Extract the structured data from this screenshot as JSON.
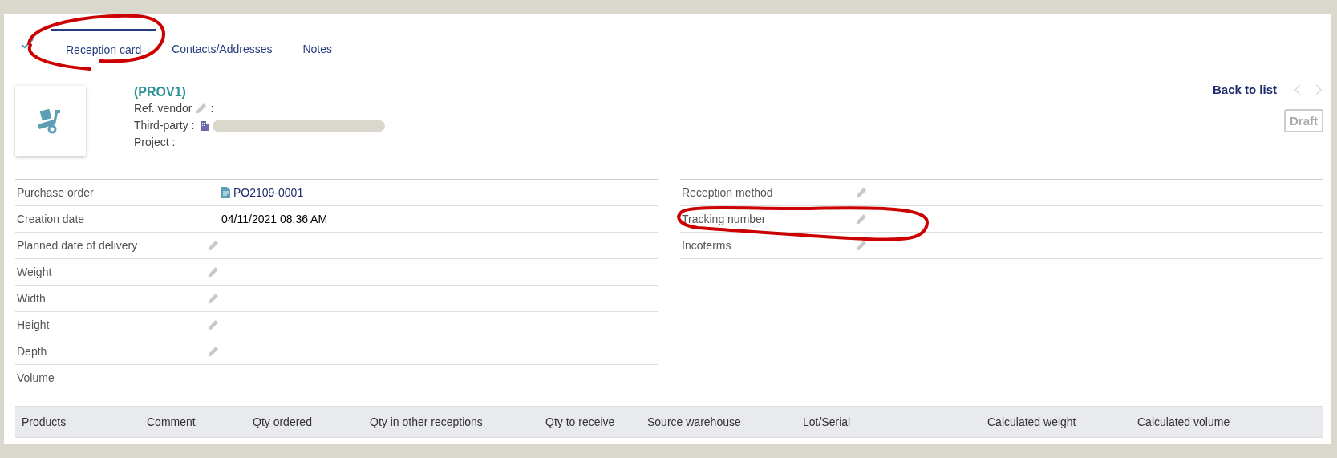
{
  "tabs": [
    {
      "label": "Reception card",
      "selected": true
    },
    {
      "label": "Contacts/Addresses",
      "selected": false
    },
    {
      "label": "Notes",
      "selected": false
    }
  ],
  "header": {
    "ref": "(PROV1)",
    "lines": [
      {
        "label": "Ref. vendor",
        "editable": true,
        "kind": "text",
        "suffix": ":"
      },
      {
        "label": "Third-party :",
        "kind": "company"
      },
      {
        "label": "Project :",
        "kind": "text"
      }
    ],
    "back_link": "Back to list",
    "prev_disabled": true,
    "next_disabled": true,
    "status": "Draft"
  },
  "left_fields": [
    {
      "label": "Purchase order",
      "value": "PO2109-0001",
      "kind": "link",
      "editable": false
    },
    {
      "label": "Creation date",
      "value": "04/11/2021 08:36 AM",
      "kind": "text",
      "editable": false
    },
    {
      "label": "Planned date of delivery",
      "editable": true
    },
    {
      "label": "Weight",
      "editable": true
    },
    {
      "label": "Width",
      "editable": true
    },
    {
      "label": "Height",
      "editable": true
    },
    {
      "label": "Depth",
      "editable": true
    },
    {
      "label": "Volume",
      "editable": false
    }
  ],
  "right_fields": [
    {
      "label": "Reception method",
      "editable": true
    },
    {
      "label": "Tracking number",
      "editable": true
    },
    {
      "label": "Incoterms",
      "editable": true
    }
  ],
  "products_table": {
    "columns": [
      "Products",
      "Comment",
      "Qty ordered",
      "Qty in other receptions",
      "Qty to receive",
      "Source warehouse",
      "Lot/Serial",
      "Calculated weight",
      "Calculated volume"
    ]
  }
}
